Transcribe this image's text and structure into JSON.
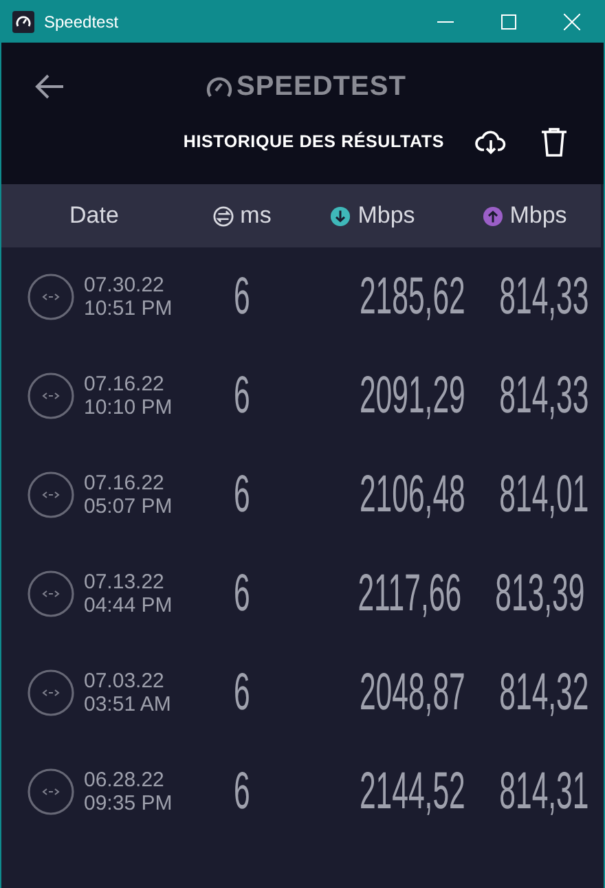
{
  "window": {
    "title": "Speedtest"
  },
  "header": {
    "logo": "SPEEDTEST",
    "title": "HISTORIQUE DES RÉSULTATS"
  },
  "columns": [
    {
      "label": "Date",
      "kind": "date"
    },
    {
      "label": "ms",
      "kind": "ping"
    },
    {
      "label": "Mbps",
      "kind": "download"
    },
    {
      "label": "Mbps",
      "kind": "upload"
    }
  ],
  "rows": [
    {
      "date": "07.30.22",
      "time": "10:51 PM",
      "ping": "6",
      "download": "2185,62",
      "upload": "814,33"
    },
    {
      "date": "07.16.22",
      "time": "10:10 PM",
      "ping": "6",
      "download": "2091,29",
      "upload": "814,33"
    },
    {
      "date": "07.16.22",
      "time": "05:07 PM",
      "ping": "6",
      "download": "2106,48",
      "upload": "814,01"
    },
    {
      "date": "07.13.22",
      "time": "04:44 PM",
      "ping": "6",
      "download": "2117,66",
      "upload": "813,39"
    },
    {
      "date": "07.03.22",
      "time": "03:51 AM",
      "ping": "6",
      "download": "2048,87",
      "upload": "814,32"
    },
    {
      "date": "06.28.22",
      "time": "09:35 PM",
      "ping": "6",
      "download": "2144,52",
      "upload": "814,31"
    }
  ]
}
